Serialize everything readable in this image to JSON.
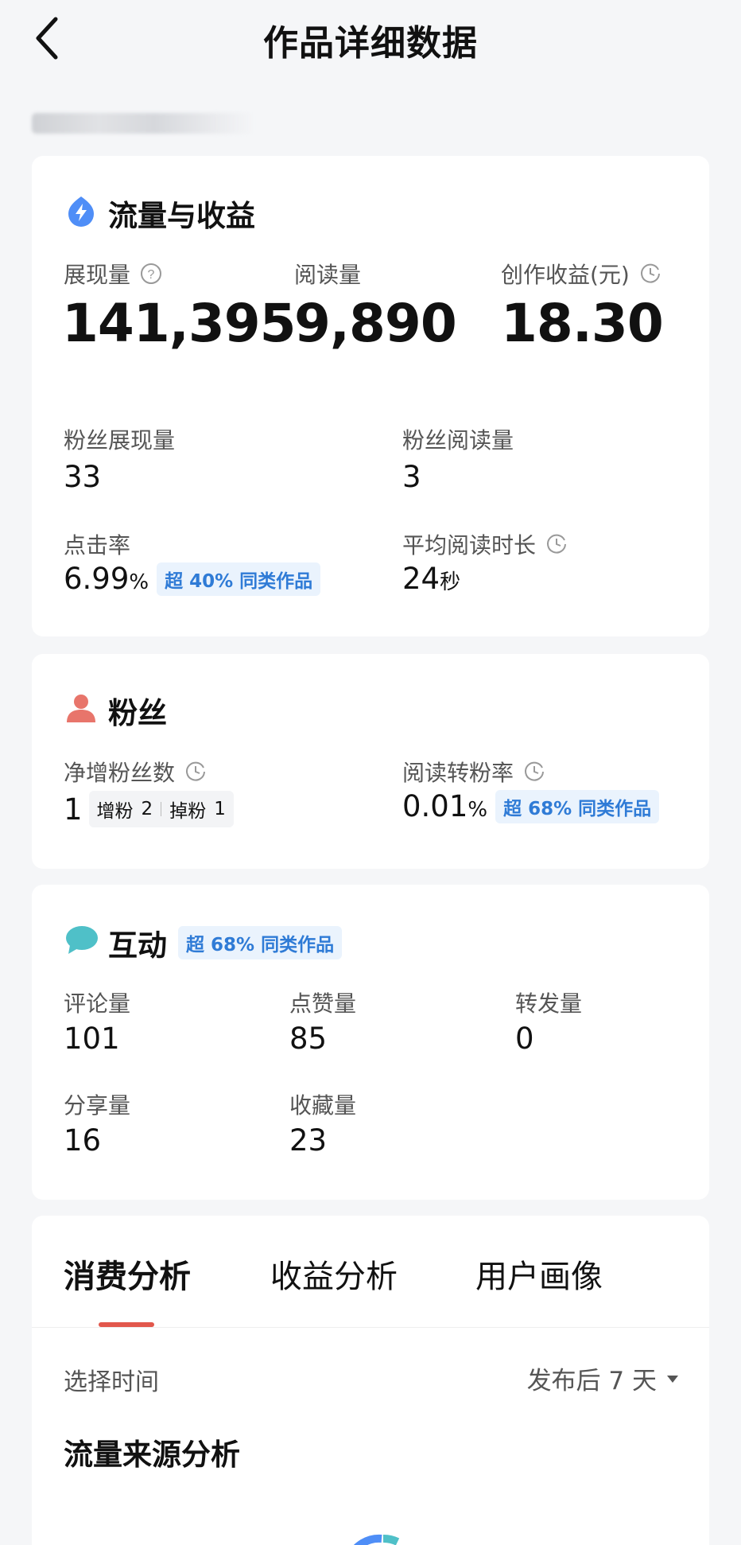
{
  "header": {
    "title": "作品详细数据"
  },
  "traffic": {
    "title": "流量与收益",
    "impressions": {
      "label": "展现量",
      "value": "141,395"
    },
    "reads": {
      "label": "阅读量",
      "value": "9,890"
    },
    "revenue": {
      "label": "创作收益(元)",
      "value": "18.30"
    },
    "fan_impressions": {
      "label": "粉丝展现量",
      "value": "33"
    },
    "fan_reads": {
      "label": "粉丝阅读量",
      "value": "3"
    },
    "ctr": {
      "label": "点击率",
      "value": "6.99",
      "unit": "%",
      "badge": "超 40% 同类作品"
    },
    "avg_read_time": {
      "label": "平均阅读时长",
      "value": "24",
      "unit": "秒"
    }
  },
  "fans": {
    "title": "粉丝",
    "net_gain": {
      "label": "净增粉丝数",
      "value": "1",
      "gain_label": "增粉",
      "gain_value": "2",
      "loss_label": "掉粉",
      "loss_value": "1"
    },
    "conversion": {
      "label": "阅读转粉率",
      "value": "0.01",
      "unit": "%",
      "badge": "超 68% 同类作品"
    }
  },
  "interaction": {
    "title": "互动",
    "badge": "超 68% 同类作品",
    "comments": {
      "label": "评论量",
      "value": "101"
    },
    "likes": {
      "label": "点赞量",
      "value": "85"
    },
    "reposts": {
      "label": "转发量",
      "value": "0"
    },
    "shares": {
      "label": "分享量",
      "value": "16"
    },
    "favorites": {
      "label": "收藏量",
      "value": "23"
    }
  },
  "tabs": [
    {
      "label": "消费分析"
    },
    {
      "label": "收益分析"
    },
    {
      "label": "用户画像"
    }
  ],
  "time_filter": {
    "label": "选择时间",
    "value": "发布后 7 天"
  },
  "source_analysis": {
    "title": "流量来源分析"
  },
  "colors": {
    "accent_blue": "#2f7bd6",
    "tab_indicator": "#e2574c",
    "fan_icon": "#e8756b",
    "chat_icon": "#4fc0c8",
    "traffic_icon": "#4f8ef7"
  }
}
